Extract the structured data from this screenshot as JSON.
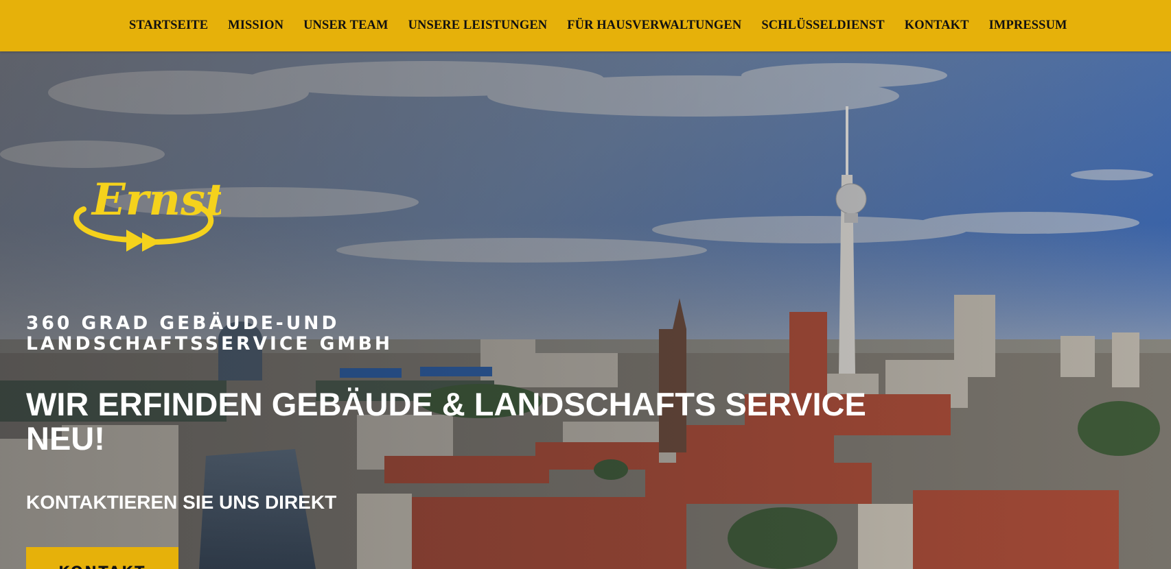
{
  "nav": {
    "items": [
      {
        "label": "STARTSEITE"
      },
      {
        "label": "MISSION"
      },
      {
        "label": "UNSER TEAM"
      },
      {
        "label": "UNSERE LEISTUNGEN"
      },
      {
        "label": "FÜR HAUSVERWALTUNGEN"
      },
      {
        "label": "SCHLÜSSELDIENST"
      },
      {
        "label": "KONTAKT"
      },
      {
        "label": "IMPRESSUM"
      }
    ]
  },
  "brand": {
    "logo_text": "Ernst",
    "logo_icon": "ernst-swirl-arrow-logo",
    "accent": "#e6b10a",
    "logo_yellow": "#f5d21c"
  },
  "hero": {
    "company": "360 GRAD GEBÄUDE-UND\nLANDSCHAFTSSERVICE GMBH",
    "headline": "WIR ERFINDEN GEBÄUDE & LANDSCHAFTS SERVICE NEU!",
    "subline": "KONTAKTIEREN SIE UNS DIREKT",
    "cta_label": "KONTAKT",
    "background": "berlin-skyline-photo"
  }
}
